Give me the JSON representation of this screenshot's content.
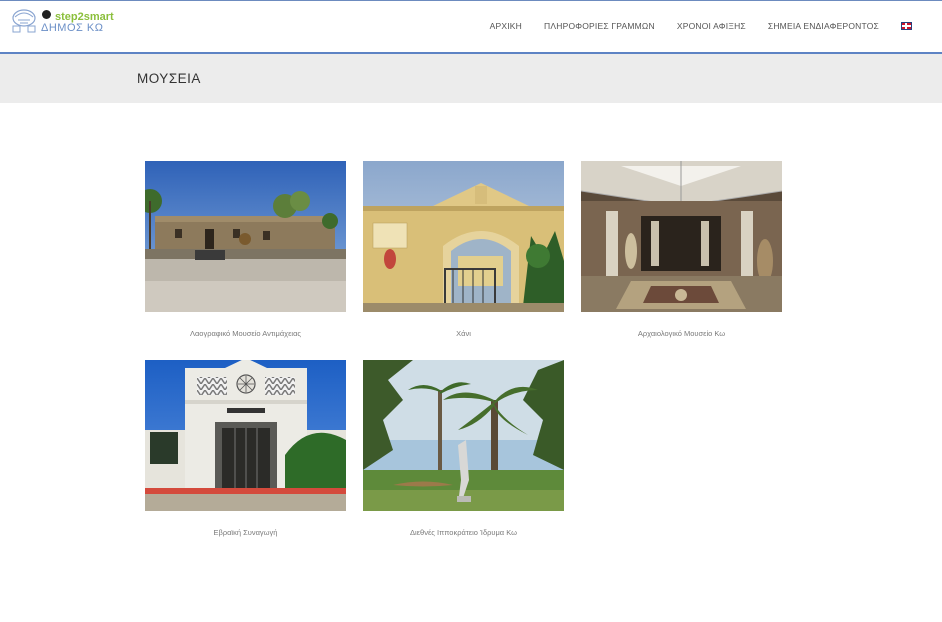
{
  "logo": {
    "brand_top": "step2smart",
    "brand_city": "ΔΗΜΟΣ ΚΩ"
  },
  "nav": {
    "items": [
      "ΑΡΧΙΚΗ",
      "ΠΛΗΡΟΦΟΡΙΕΣ ΓΡΑΜΜΩΝ",
      "ΧΡΟΝΟΙ ΑΦΙΞΗΣ",
      "ΣΗΜΕΙΑ ΕΝΔΙΑΦΕΡΟΝΤΟΣ"
    ],
    "language_icon": "uk-flag-icon"
  },
  "page": {
    "title": "ΜΟΥΣΕΙΑ"
  },
  "museums": [
    {
      "caption": "Λαογραφικό Μουσείο Αντιμάχειας"
    },
    {
      "caption": "Χάνι"
    },
    {
      "caption": "Αρχαιολογικό Μουσείο Κω"
    },
    {
      "caption": "Εβραϊκή Συναγωγή"
    },
    {
      "caption": "Διεθνές Ιπποκράτειο Ίδρυμα Κω"
    }
  ],
  "colors": {
    "accent_blue": "#5d83c4",
    "brand_green": "#8bbf3c",
    "band_gray": "#ececec"
  }
}
